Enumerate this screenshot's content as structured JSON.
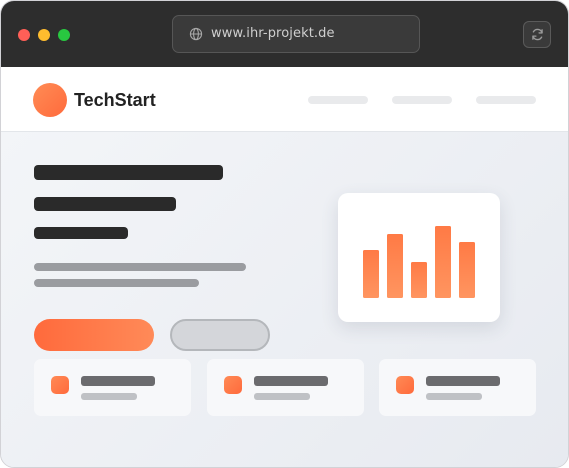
{
  "browser": {
    "url": "www.ihr-projekt.de",
    "traffic_lights": [
      "close",
      "minimize",
      "maximize"
    ],
    "colors": {
      "close": "#ff5f57",
      "minimize": "#febc2e",
      "maximize": "#28c840"
    },
    "icons": {
      "url": "globe-icon",
      "reload": "reload-icon"
    }
  },
  "site": {
    "brand": "TechStart",
    "accent": "#ff7043",
    "nav_link_count": 3
  },
  "feature_card_count": 3,
  "chart_data": {
    "type": "bar",
    "categories": [
      "",
      "",
      "",
      "",
      ""
    ],
    "values": [
      48,
      64,
      36,
      72,
      56
    ],
    "ylim": [
      0,
      80
    ],
    "title": "",
    "xlabel": "",
    "ylabel": "",
    "grid": false,
    "color": "#ff7043"
  }
}
